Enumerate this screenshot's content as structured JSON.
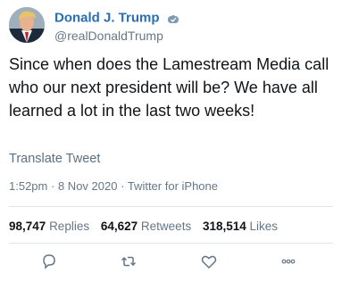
{
  "user": {
    "display_name": "Donald J. Trump",
    "handle": "@realDonaldTrump",
    "avatar_icon": "profile-photo"
  },
  "tweet": {
    "text": "Since when does the Lamestream Media call who our next president will be? We have all learned a lot in the last two weeks!",
    "translate_label": "Translate Tweet",
    "time": "1:52pm",
    "date": "8 Nov 2020",
    "source": "Twitter for iPhone",
    "separator": "·"
  },
  "stats": {
    "replies_count": "98,747",
    "replies_label": "Replies",
    "retweets_count": "64,627",
    "retweets_label": "Retweets",
    "likes_count": "318,514",
    "likes_label": "Likes"
  },
  "actions": [
    {
      "name": "reply",
      "icon": "reply-icon"
    },
    {
      "name": "retweet",
      "icon": "retweet-icon"
    },
    {
      "name": "like",
      "icon": "heart-icon"
    },
    {
      "name": "share",
      "icon": "more-icon"
    }
  ],
  "colors": {
    "name": "#2a6db3",
    "secondary_text": "#657786",
    "divider": "#dfe5ea"
  }
}
